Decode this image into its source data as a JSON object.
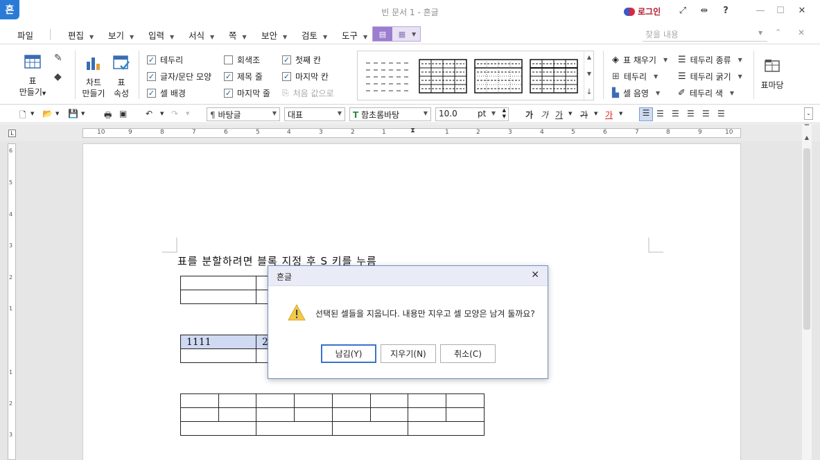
{
  "titlebar": {
    "app_badge": "흔",
    "title": "빈 문서 1 - 흔글",
    "login": "로그인"
  },
  "menubar": {
    "items": [
      "파일",
      "편집",
      "보기",
      "입력",
      "서식",
      "쪽",
      "보안",
      "검토",
      "도구"
    ],
    "search_placeholder": "찾을 내용"
  },
  "ribbon": {
    "table_make": [
      "표",
      "만들기"
    ],
    "chart_make": [
      "차트",
      "만들기"
    ],
    "table_prop": [
      "표",
      "속성"
    ],
    "checks": [
      {
        "label": "테두리",
        "checked": true
      },
      {
        "label": "글자/문단 모양",
        "checked": true
      },
      {
        "label": "셀 배경",
        "checked": true
      },
      {
        "label": "회색조",
        "checked": false
      },
      {
        "label": "제목 줄",
        "checked": true
      },
      {
        "label": "마지막 줄",
        "checked": true
      },
      {
        "label": "첫째 칸",
        "checked": true
      },
      {
        "label": "마지막 칸",
        "checked": true
      }
    ],
    "reset_label": "처음 값으로",
    "fill_label": "표 채우기",
    "border_label": "테두리",
    "shade_label": "셀 음영",
    "border_kind": "테두리 종류",
    "border_thick": "테두리 굵기",
    "border_color": "테두리 색",
    "table_madang": "표마당"
  },
  "format": {
    "style": "바탕글",
    "lang": "대표",
    "font": "함초롬바탕",
    "size": "10.0",
    "unit": "pt",
    "bold": "가",
    "italic": "가",
    "underline": "가",
    "strike": "가",
    "color_glyph": "가"
  },
  "ruler": {
    "h_numbers": [
      "10",
      "9",
      "8",
      "7",
      "6",
      "5",
      "4",
      "3",
      "2",
      "1",
      "1",
      "2",
      "3",
      "4",
      "5",
      "6",
      "7",
      "8",
      "9",
      "10"
    ],
    "v_numbers": [
      "6",
      "5",
      "4",
      "3",
      "2",
      "1",
      "1",
      "2",
      "3"
    ]
  },
  "document": {
    "instruction": "표를 분할하려면 블록 지정 후 S 키를 누름",
    "table2_cell1": "1111",
    "table2_cell2": "2"
  },
  "dialog": {
    "title": "흔글",
    "message": "선택된 셀들을 지웁니다. 내용만 지우고 셀 모양은 남겨 둘까요?",
    "btn_keep": "남김(Y)",
    "btn_erase": "지우기(N)",
    "btn_cancel": "취소(C)"
  }
}
